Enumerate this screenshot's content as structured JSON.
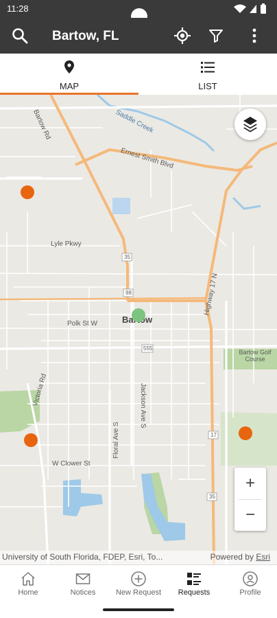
{
  "status_bar": {
    "time": "11:28"
  },
  "app_bar": {
    "title": "Bartow, FL",
    "icons": [
      "search-icon",
      "locate-icon",
      "filter-icon",
      "more-vert-icon"
    ]
  },
  "tabs": [
    {
      "label": "MAP",
      "icon": "map-pin-icon",
      "active": true
    },
    {
      "label": "LIST",
      "icon": "list-icon",
      "active": false
    }
  ],
  "map": {
    "labels": {
      "road_a": "Bartow Rd",
      "creek": "Saddle Creek",
      "ernest": "Ernest Smith Blvd",
      "lyle": "Lyle Pkwy",
      "route35": "35",
      "route98": "98",
      "polk": "Polk St W",
      "city": "Bartow",
      "highway17": "Highway 17 N",
      "golf": "Bartow Golf Course",
      "route555": "555",
      "jackson": "Jackson Ave S",
      "floral": "Floral Ave S",
      "pitcairn": "Victoria Rd",
      "clower": "W Clower St",
      "route17": "17",
      "route35b": "35"
    },
    "attribution": "University of South Florida, FDEP, Esri, To...",
    "powered_by": "Powered by",
    "powered_by_link": "Esri",
    "zoom_in": "+",
    "zoom_out": "−",
    "marker_colors": {
      "request": "#e8650f",
      "current": "#7cc47f"
    }
  },
  "bottom_nav": [
    {
      "label": "Home",
      "icon": "home-icon"
    },
    {
      "label": "Notices",
      "icon": "mail-icon"
    },
    {
      "label": "New Request",
      "icon": "add-circle-icon"
    },
    {
      "label": "Requests",
      "icon": "requests-icon"
    },
    {
      "label": "Profile",
      "icon": "profile-icon"
    }
  ],
  "colors": {
    "appbar": "#3a3a3a",
    "accent": "#e8742a",
    "road_major": "#f4b97a",
    "water": "#9ec9e8",
    "park": "#b9d6a4"
  }
}
